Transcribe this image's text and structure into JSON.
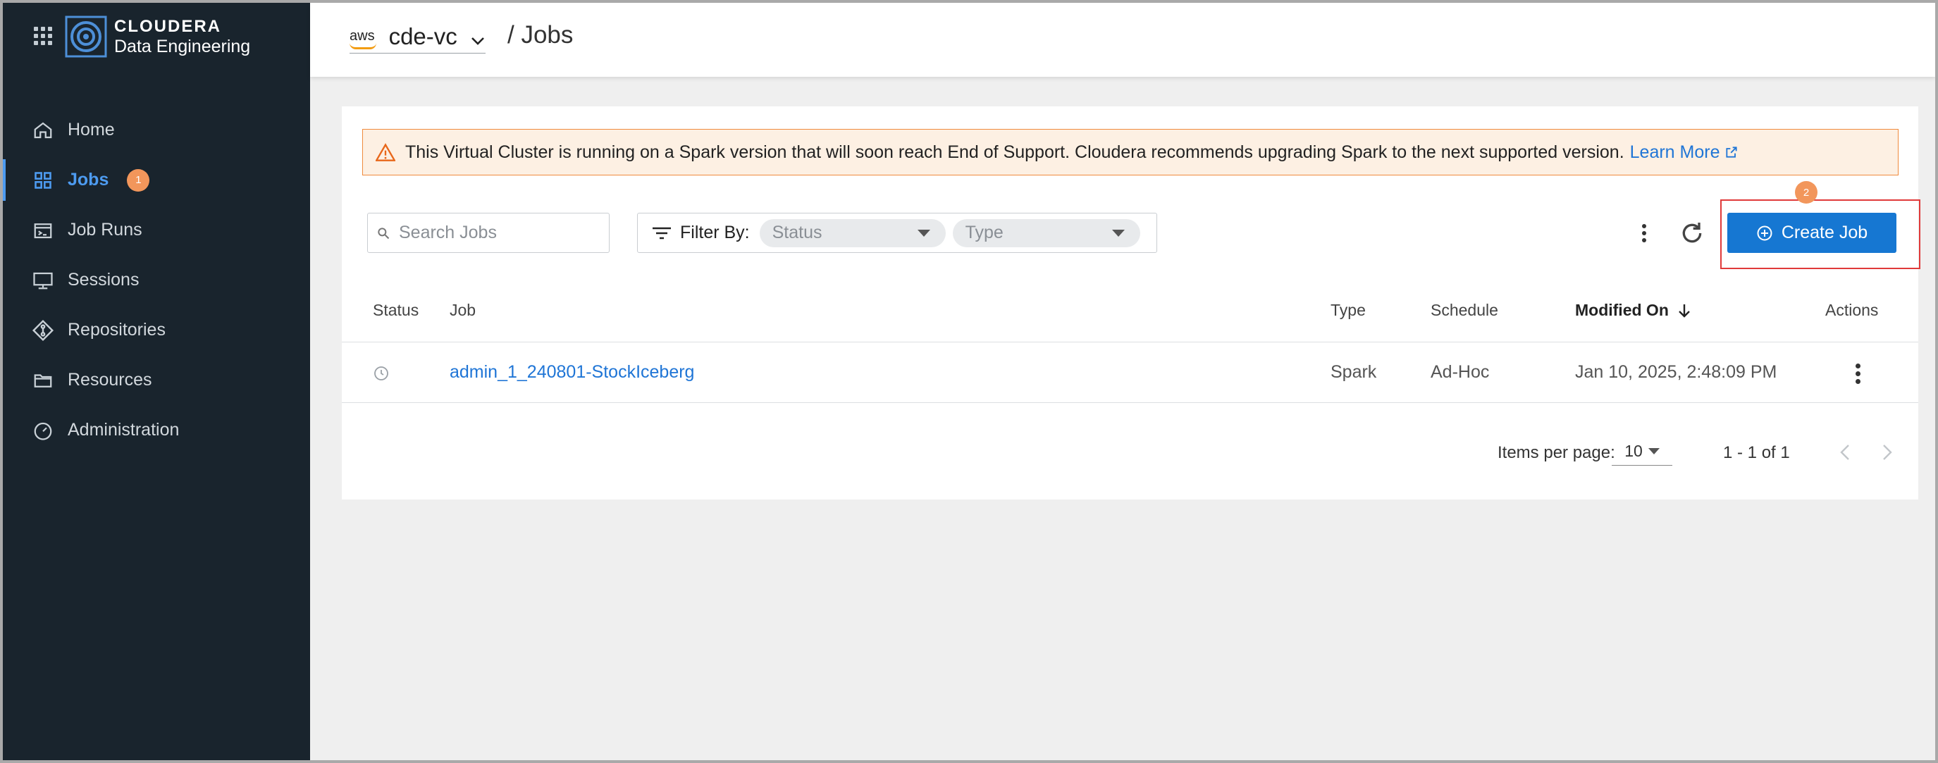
{
  "app": {
    "brand_title": "CLOUDERA",
    "brand_subtitle": "Data Engineering"
  },
  "sidebar": {
    "items": [
      {
        "label": "Home",
        "icon": "home-icon"
      },
      {
        "label": "Jobs",
        "icon": "grid-icon",
        "active": true,
        "badge": "1"
      },
      {
        "label": "Job Runs",
        "icon": "terminal-icon"
      },
      {
        "label": "Sessions",
        "icon": "monitor-icon"
      },
      {
        "label": "Repositories",
        "icon": "git-icon"
      },
      {
        "label": "Resources",
        "icon": "folder-icon"
      },
      {
        "label": "Administration",
        "icon": "gauge-icon"
      }
    ]
  },
  "header": {
    "provider": "aws",
    "cluster": "cde-vc",
    "breadcrumb": "/ Jobs"
  },
  "banner": {
    "message": "This Virtual Cluster is running on a Spark version that will soon reach End of Support. Cloudera recommends upgrading Spark to the next supported version.",
    "link": "Learn More"
  },
  "toolbar": {
    "search_placeholder": "Search Jobs",
    "filter_label": "Filter By:",
    "status_placeholder": "Status",
    "type_placeholder": "Type",
    "create_label": "Create Job",
    "create_badge": "2"
  },
  "table": {
    "columns": [
      "Status",
      "Job",
      "Type",
      "Schedule",
      "Modified On",
      "Actions"
    ],
    "rows": [
      {
        "status": "clock-icon",
        "job": "admin_1_240801-StockIceberg",
        "type": "Spark",
        "schedule": "Ad-Hoc",
        "modified": "Jan 10, 2025, 2:48:09 PM"
      }
    ]
  },
  "pagination": {
    "items_per_page_label": "Items per page:",
    "items_per_page": "10",
    "range": "1 - 1 of 1"
  },
  "colors": {
    "sidebar_bg": "#19242d",
    "accent": "#1677d2",
    "warning": "#f08a3c",
    "badge": "#f2965b",
    "highlight": "#e03a3a"
  }
}
